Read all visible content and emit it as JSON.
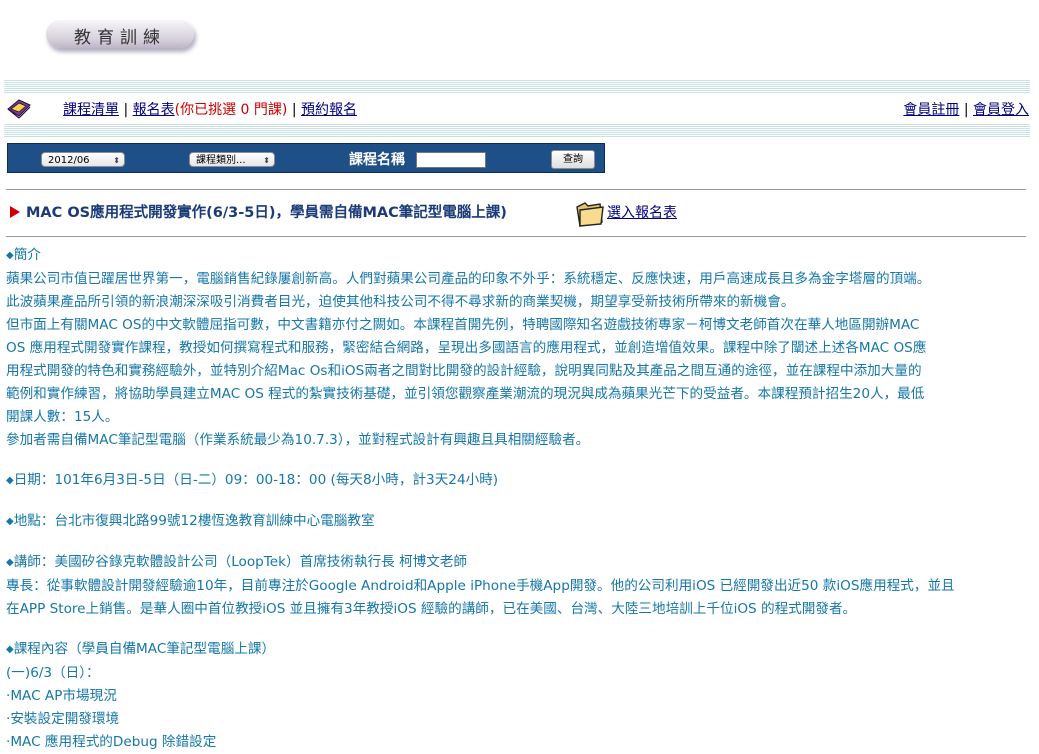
{
  "header": {
    "title": "教育訓練"
  },
  "nav": {
    "course_list": "課程清單",
    "sep1": "|",
    "signup_form": "報名表",
    "selected_note": "(你已挑選 0 門課)",
    "sep2": "|",
    "reserve": "預約報名",
    "member_register": "會員註冊",
    "sep3": "|",
    "member_login": "會員登入"
  },
  "search": {
    "month_select": "2012/06",
    "category_select": "課程類別...",
    "course_name_label": "課程名稱",
    "course_name_value": "",
    "query_button": "查詢"
  },
  "course": {
    "title": "MAC OS應用程式開發實作(6/3-5日)，學員需自備MAC筆記型電腦上課)",
    "select_link": "選入報名表"
  },
  "content": {
    "intro_heading": "簡介",
    "intro_lines": [
      "蘋果公司市值已躍居世界第一，電腦銷售紀錄屢創新高。人們對蘋果公司產品的印象不外乎：系統穩定、反應快速，用戶高速成長且多為金字塔層的頂端。",
      "此波蘋果產品所引領的新浪潮深深吸引消費者目光，迫使其他科技公司不得不尋求新的商業契機，期望享受新技術所帶來的新機會。",
      "但市面上有關MAC OS的中文軟體屈指可數，中文書籍亦付之闕如。本課程首開先例，特聘國際知名遊戲技術專家－柯博文老師首次在華人地區開辦MAC",
      "OS 應用程式開發實作課程，教授如何撰寫程式和服務，緊密結合網路，呈現出多國語言的應用程式，並創造增值效果。課程中除了闡述上述各MAC OS應",
      "用程式開發的特色和實務經驗外，並特別介紹Mac Os和iOS兩者之間對比開發的設計經驗，說明異同點及其產品之間互通的途徑，並在課程中添加大量的",
      "範例和實作練習，將協助學員建立MAC OS 程式的紮實技術基礎，並引領您觀察產業潮流的現況與成為蘋果光芒下的受益者。本課程預計招生20人，最低",
      "開課人數：15人。",
      "參加者需自備MAC筆記型電腦（作業系統最少為10.7.3），並對程式設計有興趣且具相關經驗者。"
    ],
    "date": "日期：101年6月3日-5日（日-二）09：00-18：00 (每天8小時，計3天24小時)",
    "location": "地點：台北市復興北路99號12樓恆逸教育訓練中心電腦教室",
    "instructor": "講師：美國矽谷錄克軟體設計公司（LoopTek）首席技術執行長 柯博文老師",
    "expertise_lines": [
      "專長：從事軟體設計開發經驗逾10年，目前專注於Google Android和Apple iPhone手機App開發。他的公司利用iOS 已經開發出近50 款iOS應用程式，並且",
      "在APP Store上銷售。是華人圈中首位教授iOS 並且擁有3年教授iOS 經驗的講師，已在美國、台灣、大陸三地培訓上千位iOS 的程式開發者。"
    ],
    "syllabus_heading": "課程內容（學員自備MAC筆記型電腦上課）",
    "syllabus_day1": "(一)6/3（日）：",
    "syllabus_items": [
      "·MAC AP市場現況",
      "·安裝設定開發環境",
      "·MAC 應用程式的Debug 除錯設定"
    ]
  },
  "colors": {
    "accent": "#1e4f86",
    "text": "#1677a8",
    "arrow": "#d00000"
  },
  "icons": [
    "book-icon",
    "folder-icon",
    "red-arrow-icon",
    "diamond-bullet-icon"
  ]
}
